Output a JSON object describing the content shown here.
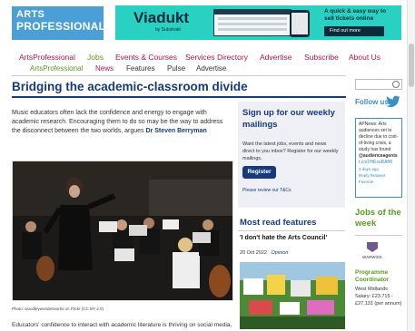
{
  "site": {
    "logo_line1": "ARTS",
    "logo_line2": "PROFESSIONAL"
  },
  "ad": {
    "brand": "Viadukt",
    "byline": "by Substrakt",
    "tagline": "A quick & easy way to sell tickets online",
    "cta": "Find out more"
  },
  "nav_primary": [
    "ArtsProfessional",
    "Jobs",
    "Events & Courses",
    "Services Directory",
    "Advertise",
    "Subscribe",
    "About Us"
  ],
  "nav_secondary": [
    "ArtsProfessional",
    "News",
    "Features",
    "Pulse",
    "Advertise"
  ],
  "article": {
    "headline": "Bridging the academic-classroom divide",
    "standfirst": "Music educators often lack the confidence and energy to engage with academic research. Encouraging them to do so may be the way to address the disconnect between the two worlds, argues",
    "author": "Dr Steven Berryman",
    "caption": "Photo: woodleywonderworks on Flickr (CC BY 2.0)",
    "body_start": "Educators' confidence to interact with academic literature is thriving on social media,"
  },
  "signup": {
    "heading": "Sign up for our weekly mailings",
    "text": "Want the latest jobs, events and news direct to you inbox? Register for our weekly mailings.",
    "button": "Register",
    "tbc_link": "Please review our T&Cs"
  },
  "most_read": {
    "heading": "Most read features",
    "item_title": "'I don't hate the Arts Council'",
    "item_date": "20 Oct 2022",
    "item_category": "Opinion"
  },
  "sidebar": {
    "search_placeholder": "",
    "follow_us": "Follow us",
    "tweet_text": "APNews: Arts audiences set to decline due to cost-of-living crisis, a study has found",
    "tweet_handle": "@audienceagents",
    "tweet_link": "t.co/ZHEsuBAfM",
    "tweet_time": "3 days ago",
    "tweet_actions": "Reply Retweet Favorite",
    "jobs_heading": "Jobs of the week",
    "job_logo_text": "WARWICK",
    "job_title": "Programme Coordinator",
    "job_location": "West Midlands",
    "job_salary": "Salary: £23,715 - £27,131 (per annum)"
  },
  "colors": {
    "brand_blue": "#173a7d",
    "logo_blue": "#4aa0d6",
    "jobs_green": "#5a9a1e",
    "nav_red": "#b3134b",
    "ad_teal": "#29d1c3"
  }
}
